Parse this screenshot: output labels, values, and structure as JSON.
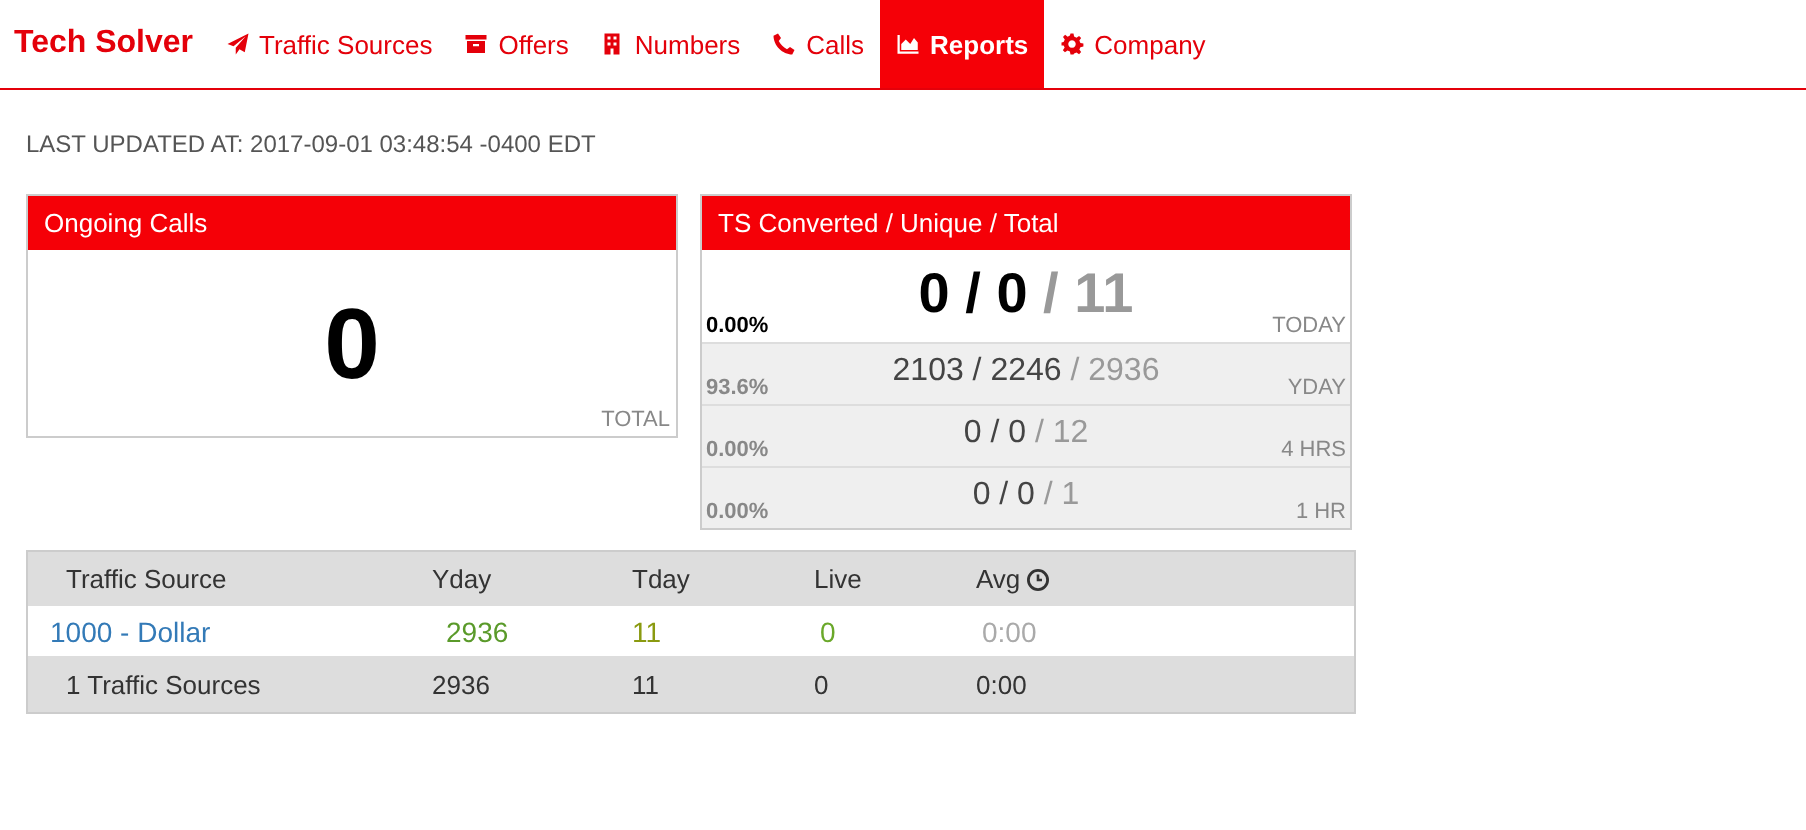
{
  "brand": "Tech Solver",
  "nav": [
    {
      "label": "Traffic Sources",
      "selected": false
    },
    {
      "label": "Offers",
      "selected": false
    },
    {
      "label": "Numbers",
      "selected": false
    },
    {
      "label": "Calls",
      "selected": false
    },
    {
      "label": "Reports",
      "selected": true
    },
    {
      "label": "Company",
      "selected": false
    }
  ],
  "last_updated": "LAST UPDATED AT: 2017-09-01 03:48:54 -0400 EDT",
  "ongoing": {
    "title": "Ongoing Calls",
    "value": "0",
    "caption": "TOTAL"
  },
  "ts": {
    "title": "TS Converted / Unique / Total",
    "rows": [
      {
        "kind": "primary",
        "percent": "0.00%",
        "counts": "0 / 0",
        "total": "/ 11",
        "period": "TODAY"
      },
      {
        "kind": "secondary",
        "percent": "93.6%",
        "counts": "2103 / 2246",
        "total": "/ 2936",
        "period": "YDAY"
      },
      {
        "kind": "secondary",
        "percent": "0.00%",
        "counts": "0 / 0",
        "total": "/ 12",
        "period": "4 HRS"
      },
      {
        "kind": "secondary",
        "percent": "0.00%",
        "counts": "0 / 0",
        "total": "/ 1",
        "period": "1 HR"
      }
    ]
  },
  "table": {
    "columns": [
      {
        "label": "Traffic Source",
        "clock": false
      },
      {
        "label": "Yday",
        "clock": false
      },
      {
        "label": "Tday",
        "clock": false
      },
      {
        "label": "Live",
        "clock": false
      },
      {
        "label": "Avg",
        "clock": true
      }
    ],
    "rows": [
      {
        "kind": "data",
        "cells": [
          "1000 - Dollar",
          "2936",
          "11",
          "0",
          "0:00"
        ]
      },
      {
        "kind": "total",
        "cells": [
          "1 Traffic Sources",
          "2936",
          "11",
          "0",
          "0:00"
        ]
      }
    ]
  }
}
